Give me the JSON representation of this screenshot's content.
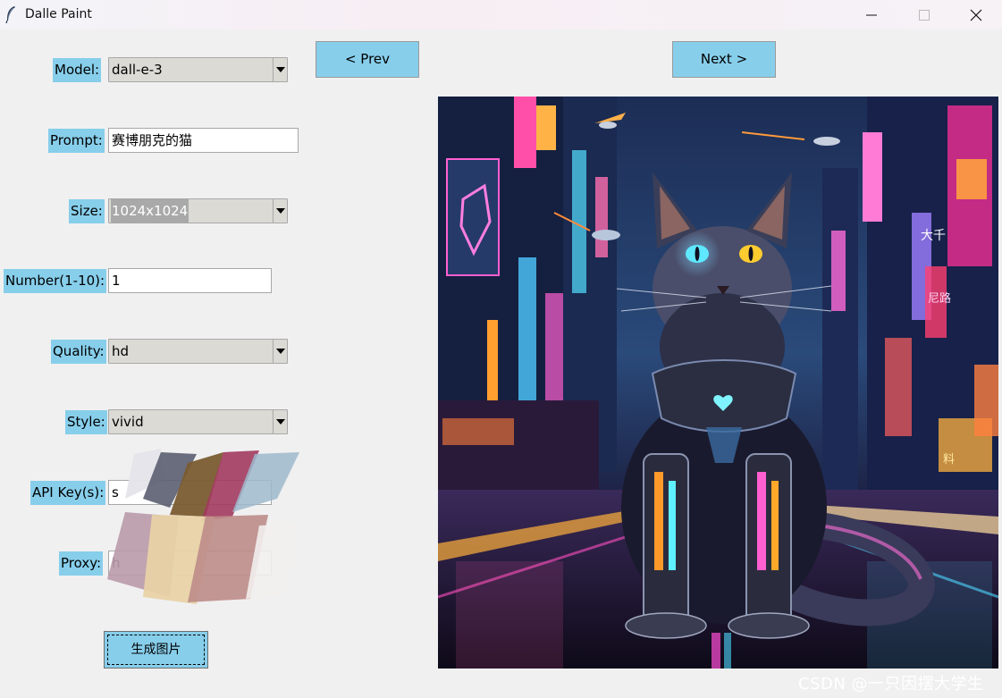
{
  "window": {
    "title": "Dalle Paint",
    "app_icon": "feather-icon",
    "controls": [
      "minimize-icon",
      "maximize-icon",
      "close-icon"
    ]
  },
  "form": {
    "model": {
      "label": "Model:",
      "value": "dall-e-3"
    },
    "prompt": {
      "label": "Prompt:",
      "value": "赛博朋克的猫"
    },
    "size": {
      "label": "Size:",
      "value": "1024x1024"
    },
    "number": {
      "label": "Number(1-10):",
      "value": "1"
    },
    "quality": {
      "label": "Quality:",
      "value": "hd"
    },
    "style": {
      "label": "Style:",
      "value": "vivid"
    },
    "api_key": {
      "label": "API Key(s):",
      "value": "s"
    },
    "proxy": {
      "label": "Proxy:",
      "value": "h"
    },
    "generate_label": "生成图片"
  },
  "nav": {
    "prev_label": "< Prev",
    "next_label": "Next >"
  },
  "image": {
    "description_icon": "generated-image",
    "signs": [
      "大千",
      "尼路",
      "料"
    ]
  },
  "watermark": "CSDN @一只因摆大学生",
  "colors": {
    "accent": "#87ceeb",
    "combo_bg": "#dcdad5",
    "window_bg": "#f0f0f0"
  }
}
